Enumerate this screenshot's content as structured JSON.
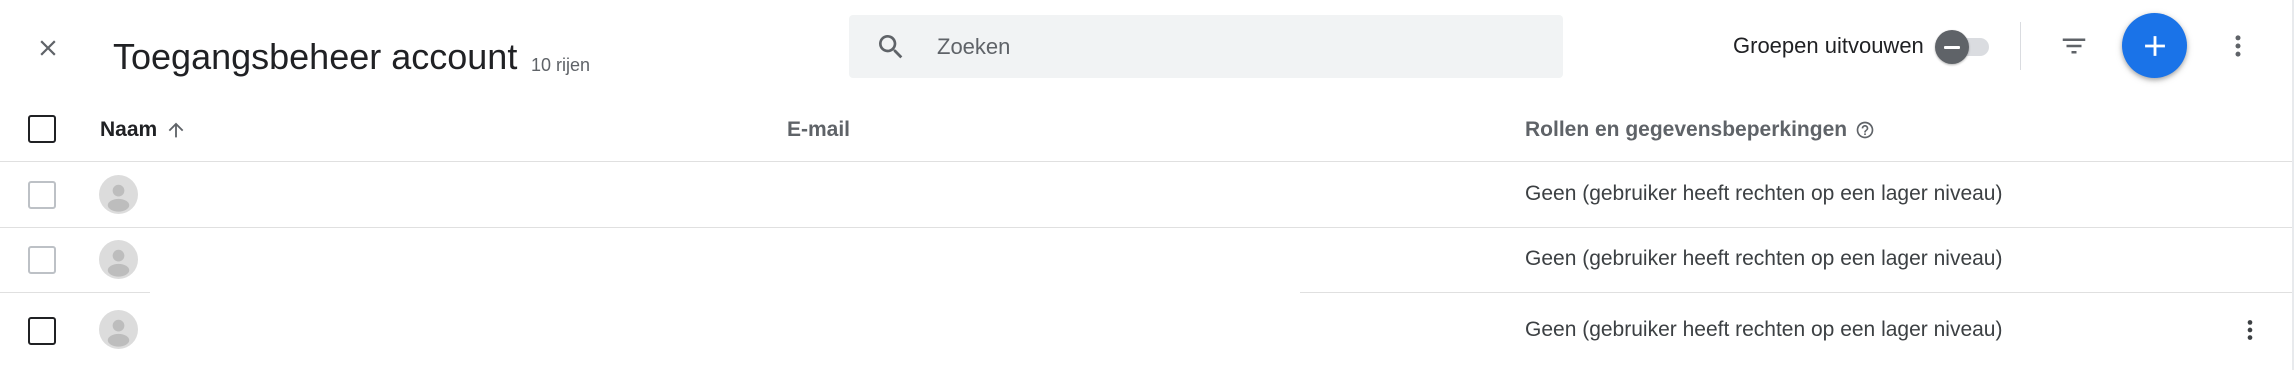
{
  "header": {
    "title": "Toegangsbeheer account",
    "row_count": "10 rijen",
    "search_placeholder": "Zoeken",
    "group_toggle_label": "Groepen uitvouwen"
  },
  "icons": {
    "close": "close-icon",
    "search": "search-icon",
    "filter": "filter-icon",
    "add": "add-icon",
    "more": "more-vert-icon",
    "sort": "arrow-upward-icon",
    "help": "help-outline-icon",
    "avatar": "person-icon"
  },
  "colors": {
    "accent": "#1a73e8",
    "search_bg": "#f1f3f4",
    "toggle_knob": "#5f6368",
    "avatar_bg": "#dcdcdc"
  },
  "table": {
    "columns": {
      "name": "Naam",
      "email": "E-mail",
      "roles": "Rollen en gegevensbeperkingen"
    },
    "rows": [
      {
        "roles": "Geen (gebruiker heeft rechten op een lager niveau)"
      },
      {
        "roles": "Geen (gebruiker heeft rechten op een lager niveau)"
      },
      {
        "roles": "Geen (gebruiker heeft rechten op een lager niveau)"
      }
    ]
  }
}
